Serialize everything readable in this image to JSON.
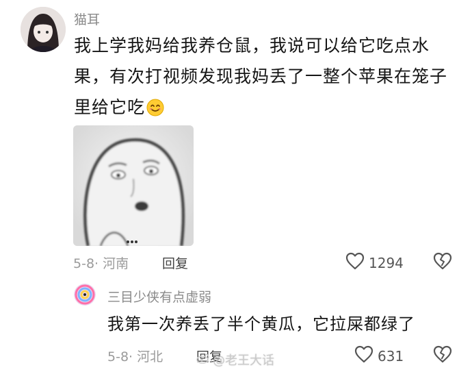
{
  "comment": {
    "username": "猫耳",
    "text": "我上学我妈给我养仓鼠，我说可以给它吃点水果，有次打视频发现我妈丢了一整个苹果在笼子里给它吃",
    "date_location": "5-8· 河南",
    "reply_label": "回复",
    "like_count": "1294"
  },
  "reply": {
    "username": "三目少侠有点虚弱",
    "text": "我第一次养丢了半个黄瓜，它拉屎都绿了",
    "date_location": "5-8· 河北",
    "reply_label": "回复",
    "like_count": "631"
  },
  "watermark": "@老王大话",
  "icons": {
    "like": "heart-outline-icon",
    "dislike": "broken-heart-icon",
    "emoji": "smiling-face-emoji"
  },
  "colors": {
    "text": "#151515",
    "muted": "#9a9a9a",
    "username": "#8a8a8a"
  }
}
